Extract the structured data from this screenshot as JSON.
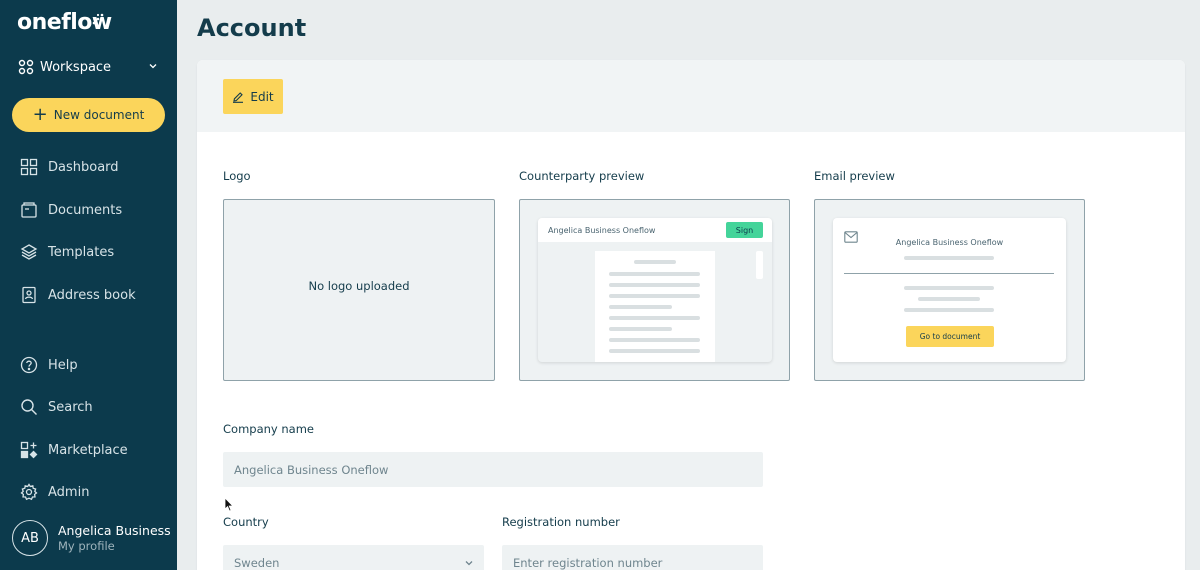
{
  "brand": {
    "name": "oneflow"
  },
  "sidebar": {
    "workspace_label": "Workspace",
    "new_document_label": "New document",
    "nav": {
      "dashboard": "Dashboard",
      "documents": "Documents",
      "templates": "Templates",
      "address_book": "Address book",
      "help": "Help",
      "search": "Search",
      "marketplace": "Marketplace",
      "admin": "Admin"
    },
    "profile": {
      "initials": "AB",
      "name": "Angelica Business",
      "subtitle": "My profile"
    }
  },
  "page": {
    "title": "Account"
  },
  "toolbar": {
    "edit_label": "Edit"
  },
  "previews": {
    "logo_label": "Logo",
    "no_logo_text": "No logo uploaded",
    "counterparty_label": "Counterparty preview",
    "counterparty_company": "Angelica Business Oneflow",
    "counterparty_sign": "Sign",
    "email_label": "Email preview",
    "email_company": "Angelica Business Oneflow",
    "email_button": "Go to document"
  },
  "form": {
    "company_name_label": "Company name",
    "company_name_value": "Angelica Business Oneflow",
    "country_label": "Country",
    "country_value": "Sweden",
    "registration_label": "Registration number",
    "registration_placeholder": "Enter registration number"
  },
  "colors": {
    "sidebar_bg": "#0c3a4c",
    "accent_yellow": "#fbd55b",
    "sign_green": "#44d49a",
    "text_dark": "#143c4b"
  }
}
